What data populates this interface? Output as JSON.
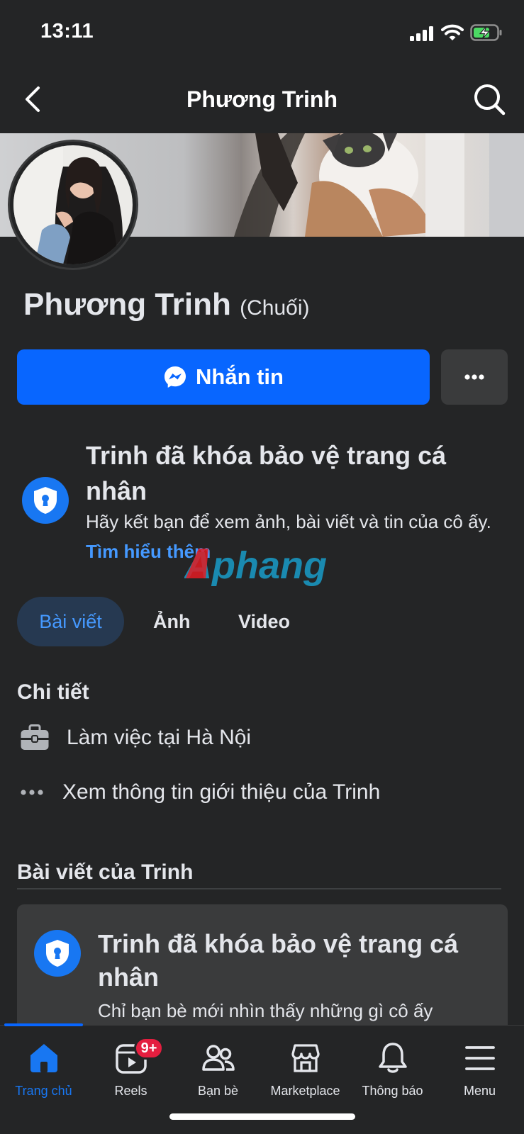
{
  "status_bar": {
    "time": "13:11"
  },
  "nav": {
    "title": "Phương Trinh"
  },
  "profile": {
    "name": "Phương Trinh",
    "nickname": "(Chuối)"
  },
  "actions": {
    "message_label": "Nhắn tin"
  },
  "lock_notice": {
    "title": "Trinh đã khóa bảo vệ trang cá nhân",
    "description": "Hãy kết bạn để xem ảnh, bài viết và tin của cô ấy.",
    "link": "Tìm hiểu thêm"
  },
  "watermark": "Aphang",
  "tabs": [
    {
      "label": "Bài viết",
      "active": true
    },
    {
      "label": "Ảnh",
      "active": false
    },
    {
      "label": "Video",
      "active": false
    }
  ],
  "details": {
    "title": "Chi tiết",
    "work": "Làm việc tại Hà Nội",
    "about": "Xem thông tin giới thiệu của Trinh"
  },
  "posts": {
    "title": "Bài viết của Trinh",
    "card_title": "Trinh đã khóa bảo vệ trang cá nhân",
    "card_desc": "Chỉ bạn bè mới nhìn thấy những gì cô ấy"
  },
  "bottom_nav": [
    {
      "label": "Trang chủ",
      "icon": "home-icon",
      "active": true
    },
    {
      "label": "Reels",
      "icon": "reels-icon",
      "badge": "9+"
    },
    {
      "label": "Bạn bè",
      "icon": "friends-icon"
    },
    {
      "label": "Marketplace",
      "icon": "marketplace-icon"
    },
    {
      "label": "Thông báo",
      "icon": "bell-icon"
    },
    {
      "label": "Menu",
      "icon": "menu-icon"
    }
  ],
  "colors": {
    "accent": "#0866ff",
    "background": "#242526",
    "link": "#4599ff",
    "badge": "#e41e3f"
  }
}
